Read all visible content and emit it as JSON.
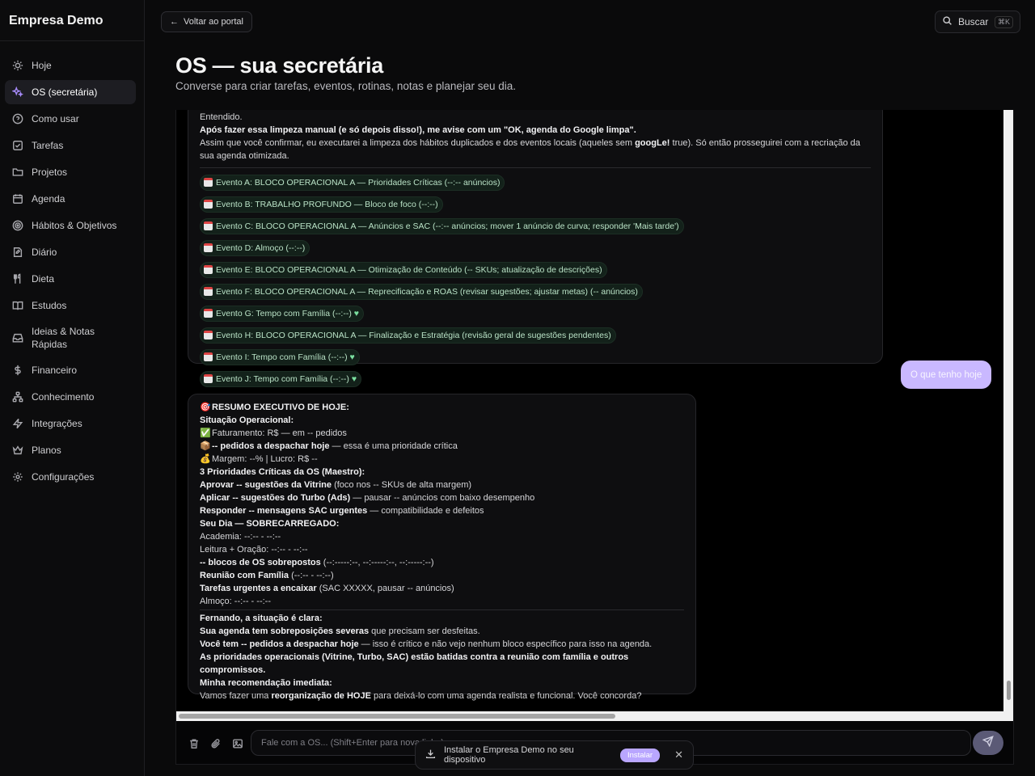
{
  "brand": "Empresa Demo",
  "nav": [
    {
      "label": "Hoje",
      "icon": "sun-icon"
    },
    {
      "label": "OS (secretária)",
      "icon": "sparkles-icon"
    },
    {
      "label": "Como usar",
      "icon": "help-circle-icon"
    },
    {
      "label": "Tarefas",
      "icon": "checkbox-icon"
    },
    {
      "label": "Projetos",
      "icon": "folder-icon"
    },
    {
      "label": "Agenda",
      "icon": "calendar-icon"
    },
    {
      "label": "Hábitos & Objetivos",
      "icon": "target-icon"
    },
    {
      "label": "Diário",
      "icon": "notebook-icon"
    },
    {
      "label": "Dieta",
      "icon": "utensils-icon"
    },
    {
      "label": "Estudos",
      "icon": "book-icon"
    },
    {
      "label": "Ideias & Notas Rápidas",
      "icon": "inbox-icon"
    },
    {
      "label": "Financeiro",
      "icon": "dollar-icon"
    },
    {
      "label": "Conhecimento",
      "icon": "network-icon"
    },
    {
      "label": "Integrações",
      "icon": "zap-icon"
    },
    {
      "label": "Planos",
      "icon": "crown-icon"
    },
    {
      "label": "Configurações",
      "icon": "gear-icon"
    }
  ],
  "topbar": {
    "back_label": "Voltar ao portal",
    "search_label": "Buscar",
    "search_shortcut": "⌘K"
  },
  "page": {
    "title": "OS — sua secretária",
    "subtitle": "Converse para criar tarefas, eventos, rotinas, notas e planejar seu dia."
  },
  "msg1": {
    "l1": "Entendido.",
    "l2": "Após fazer essa limpeza manual (e só depois disso!), me avise com um \"OK, agenda do Google limpa\".",
    "l3a": "Assim que você confirmar, eu executarei a limpeza dos hábitos duplicados e dos eventos locais (aqueles sem ",
    "l3b": "googLe!",
    "l3c": "  true). Só então prosseguirei com a recriação da sua agenda otimizada.",
    "events": [
      "Evento A: BLOCO OPERACIONAL A — Prioridades Críticas (--:-- anúncios)",
      "Evento B: TRABALHO PROFUNDO — Bloco de foco (--:--)",
      "Evento C: BLOCO OPERACIONAL A — Anúncios e SAC (--:-- anúncios; mover 1 anúncio de curva; responder 'Mais tarde')",
      "Evento D: Almoço (--:--)",
      "Evento E: BLOCO OPERACIONAL A — Otimização de Conteúdo (-- SKUs; atualização de descrições)",
      "Evento F: BLOCO OPERACIONAL A — Reprecificação e ROAS (revisar sugestões; ajustar metas) (-- anúncios)",
      "Evento G: Tempo com Família (--:--)",
      "Evento H: BLOCO OPERACIONAL A — Finalização e Estratégia (revisão geral de sugestões pendentes)",
      "Evento I: Tempo com Família (--:--)",
      "Evento J: Tempo com Família (--:--)"
    ]
  },
  "user_msg": "O que tenho hoje",
  "msg2": {
    "title": "RESUMO EXECUTIVO DE HOJE:",
    "sec1": "Situação Operacional:",
    "fat": "Faturamento: R$ — em -- pedidos",
    "ped_b": "-- pedidos a despachar hoje",
    "ped_r": " — essa é uma prioridade crítica",
    "marg": "Margem: --% | Lucro: R$ --",
    "sec2": "3 Prioridades Críticas da OS (Maestro):",
    "p1_b": "Aprovar -- sugestões da Vitrine",
    "p1_r": " (foco nos -- SKUs de alta margem)",
    "p2_b": "Aplicar -- sugestões do Turbo (Ads)",
    "p2_r": " — pausar -- anúncios com baixo desempenho",
    "p3_b": "Responder -- mensagens SAC urgentes",
    "p3_r": " — compatibilidade e defeitos",
    "sec3": "Seu Dia — SOBRECARREGADO:",
    "d1": "Academia: --:-- - --:--",
    "d2": "Leitura + Oração: --:-- - --:--",
    "d3_b": "-- blocos de OS sobrepostos",
    "d3_r": " (--:-----:--, --:-----:--, --:-----:--)",
    "d4_b": "Reunião com Família",
    "d4_r": " (--:-- - --:--)",
    "d5_b": "Tarefas urgentes a encaixar",
    "d5_r": " (SAC XXXXX, pausar -- anúncios)",
    "d6": "Almoço: --:-- - --:--",
    "f1": "Fernando, a situação é clara:",
    "f2_b": "Sua agenda tem sobreposições severas",
    "f2_r": " que precisam ser desfeitas.",
    "f3_b": "Você tem -- pedidos a despachar hoje",
    "f3_r": " — isso é crítico e não vejo nenhum bloco específico para isso na agenda.",
    "f4": "As prioridades operacionais (Vitrine, Turbo, SAC) estão batidas contra a reunião com família e outros compromissos.",
    "f5": "Minha recomendação imediata:",
    "f6_a": "Vamos fazer uma ",
    "f6_b": "reorganização de HOJE",
    "f6_c": " para deixá-lo com uma agenda realista e funcional. Você concorda?"
  },
  "composer": {
    "placeholder": "Fale com a OS... (Shift+Enter para nova linha)"
  },
  "toast": {
    "text": "Instalar o Empresa Demo no seu dispositivo",
    "install_label": "Instalar",
    "close": "✕"
  },
  "colors": {
    "accent": "#a78bfa",
    "user_bubble": "#c9b8ff",
    "chip_bg": "#13211a"
  }
}
